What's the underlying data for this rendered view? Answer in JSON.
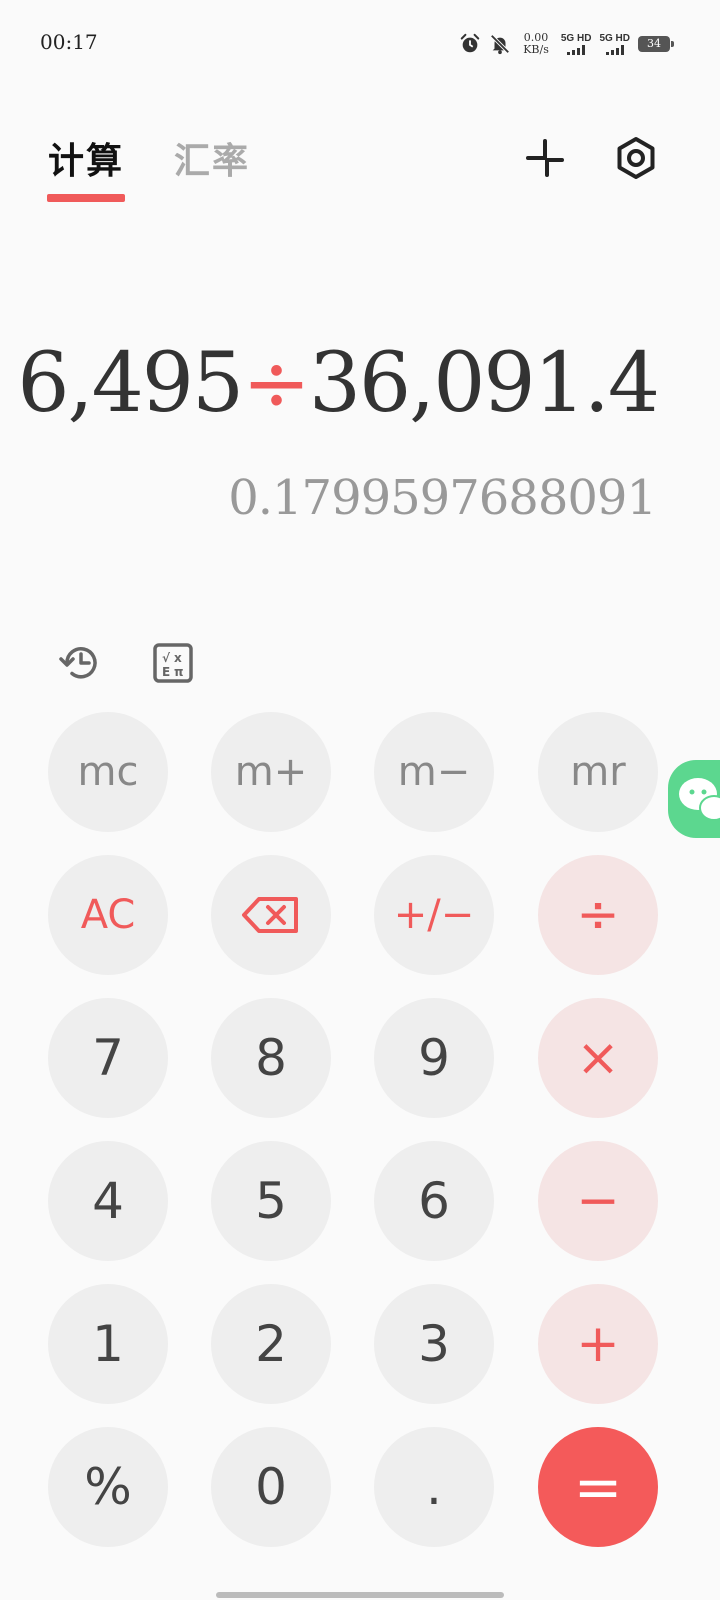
{
  "status_bar": {
    "time": "00:17",
    "net_speed_value": "0.00",
    "net_speed_unit": "KB/s",
    "sim1_label": "5G HD",
    "sim2_label": "5G HD",
    "battery": "34"
  },
  "tabs": [
    {
      "label": "计算",
      "active": true
    },
    {
      "label": "汇率",
      "active": false
    }
  ],
  "display": {
    "operand1": "6,495",
    "operator": "÷",
    "operand2": "36,091.4",
    "result": "0.1799597688091"
  },
  "keys": {
    "mc": "mc",
    "mplus": "m+",
    "mminus": "m−",
    "mr": "mr",
    "ac": "AC",
    "sign": "+/−",
    "divide": "÷",
    "seven": "7",
    "eight": "8",
    "nine": "9",
    "multiply": "×",
    "four": "4",
    "five": "5",
    "six": "6",
    "minus": "−",
    "one": "1",
    "two": "2",
    "three": "3",
    "plus": "+",
    "percent": "%",
    "zero": "0",
    "dot": ".",
    "equals": "="
  },
  "colors": {
    "accent": "#f05a5a",
    "equals_bg": "#f45a5a",
    "operator_bg": "#f5e4e4",
    "key_bg": "#eeeeee",
    "background": "#fafafa"
  },
  "icons": {
    "collapse": "collapse-icon",
    "settings": "settings-icon",
    "history": "history-icon",
    "scientific": "scientific-mode-icon",
    "backspace": "backspace-icon",
    "floating": "wechat-bubble-icon"
  }
}
